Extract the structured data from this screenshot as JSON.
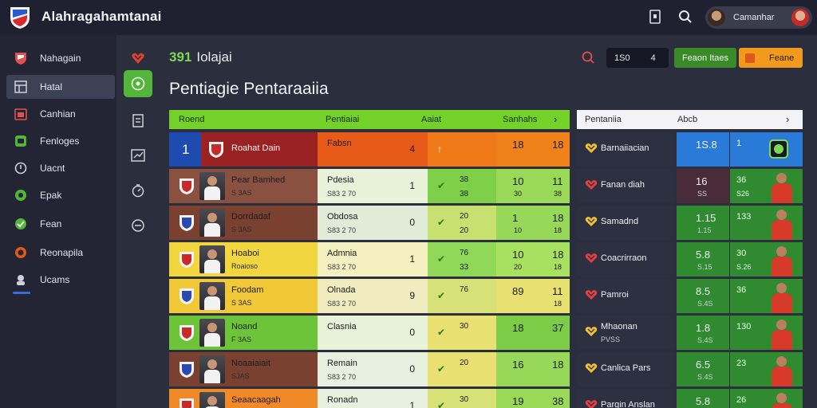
{
  "app": {
    "title": "Alahraga​hamtanai",
    "user_name": "Camanhar"
  },
  "sidebar": {
    "items": [
      {
        "label": "Nahagain",
        "icon": "shield-icon",
        "color": "#e05050"
      },
      {
        "label": "Hatal",
        "icon": "table-icon",
        "color": "#d0d0d8",
        "active": true
      },
      {
        "label": "Canhian",
        "icon": "calendar-icon",
        "color": "#e05050"
      },
      {
        "label": "Fenloges",
        "icon": "chat-icon",
        "color": "#53b63a"
      },
      {
        "label": "Uacnt",
        "icon": "circle-icon",
        "color": "#d0d0d8"
      },
      {
        "label": "Epak",
        "icon": "gear-icon",
        "color": "#53b63a"
      },
      {
        "label": "Fean",
        "icon": "check-icon",
        "color": "#53b63a"
      },
      {
        "label": "Reonapila",
        "icon": "target-icon",
        "color": "#e0581a"
      },
      {
        "label": "Ucams",
        "icon": "users-icon",
        "color": "#d0d0d8"
      }
    ]
  },
  "header": {
    "section_number": "391",
    "section_label": "Iolajai",
    "page_title": "Pentiagie Pentaraaiia",
    "dark_pill": {
      "a": "1S0",
      "b": "4"
    },
    "green_button": "Feaon Itaes",
    "orange_button": "Feane"
  },
  "table": {
    "headers": {
      "col1": "Roend",
      "col2": "Pentiaiai",
      "col3": "Aaiat",
      "col4": "Sanhahs"
    },
    "rows": [
      {
        "name": "Roahat Dain",
        "sub": "",
        "rank": "1",
        "opp": "Fabsn",
        "opp_sub": "",
        "opp_num": "4",
        "mark": "↑",
        "v3": "",
        "v3b": "",
        "v4": "18",
        "v5": "18",
        "v4b": "",
        "v5b": "",
        "c1": "#9a2222",
        "c2": "#e85a18",
        "c3": "#f07a18",
        "c4": "#f0801a"
      },
      {
        "name": "Pear Bamhed",
        "sub": "S 3AS",
        "opp": "Pdesia",
        "opp_sub": "S83 2 70",
        "opp_num": "1",
        "mark": "✔",
        "v3": "38",
        "v3b": "38",
        "v4": "10",
        "v5": "11",
        "v4b": "30",
        "v5b": "38",
        "c1": "#8a5040",
        "c2": "#e8f2d8",
        "c3": "#7dd048",
        "c4": "#9ad858"
      },
      {
        "name": "Dorrdadaf",
        "sub": "S 3AS",
        "opp": "Obdosa",
        "opp_sub": "S83 2 70",
        "opp_num": "0",
        "mark": "✔",
        "v3": "20",
        "v3b": "20",
        "v4": "1",
        "v5": "18",
        "v4b": "10",
        "v5b": "18",
        "c1": "#7a4030",
        "c2": "#e0ecd8",
        "c3": "#c8e070",
        "c4": "#98d858"
      },
      {
        "name": "Hoaboi",
        "sub": "Roaioso",
        "opp": "Admnia",
        "opp_sub": "S83 2 70",
        "opp_num": "1",
        "mark": "✔",
        "v3": "76",
        "v3b": "33",
        "v4": "10",
        "v5": "18",
        "v4b": "20",
        "v5b": "18",
        "c1": "#f2d640",
        "c2": "#f4f0c0",
        "c3": "#8fd858",
        "c4": "#a8e060"
      },
      {
        "name": "Foodam",
        "sub": "S 3AS",
        "opp": "Olnada",
        "opp_sub": "S83 2 70",
        "opp_num": "9",
        "mark": "✔",
        "v3": "76",
        "v3b": "",
        "v4": "89",
        "v5": "11",
        "v4b": "",
        "v5b": "18",
        "c1": "#f0c838",
        "c2": "#f0ecc0",
        "c3": "#d8e078",
        "c4": "#e8e070"
      },
      {
        "name": "Noand",
        "sub": "F 3AS",
        "opp": "Clasnia",
        "opp_sub": "",
        "opp_num": "0",
        "mark": "✔",
        "v3": "30",
        "v3b": "",
        "v4": "18",
        "v5": "37",
        "v4b": "",
        "v5b": "",
        "c1": "#6ec438",
        "c2": "#e8f2d8",
        "c3": "#e8e070",
        "c4": "#7dcc48"
      },
      {
        "name": "Noaaiaiait",
        "sub": "SJAS",
        "opp": "Remain",
        "opp_sub": "S83 2 70",
        "opp_num": "0",
        "mark": "✔",
        "v3": "20",
        "v3b": "",
        "v4": "16",
        "v5": "18",
        "v4b": "",
        "v5b": "",
        "c1": "#7a4030",
        "c2": "#e8f0e0",
        "c3": "#e8e070",
        "c4": "#98d858"
      },
      {
        "name": "Seaacaagah",
        "sub": "",
        "opp": "Ronadn",
        "opp_sub": "",
        "opp_num": "1",
        "mark": "✔",
        "v3": "30",
        "v3b": "",
        "v4": "19",
        "v5": "38",
        "v4b": "",
        "v5b": "",
        "c1": "#f08a28",
        "c2": "#e8f0e0",
        "c3": "#d8e078",
        "c4": "#9ad858"
      }
    ]
  },
  "panel": {
    "headers": {
      "col1": "Pentaniia",
      "col2": "Abcb"
    },
    "rows": [
      {
        "name": "Barnaiiacian",
        "sub": "",
        "v": "1S.8",
        "vb": "",
        "n": "1",
        "nb": "",
        "icon_color": "#f2c030",
        "r2": "#2a7ad8",
        "r3": "#2a7ad8"
      },
      {
        "name": "Fanan diah",
        "sub": "",
        "v": "16",
        "vb": "SS",
        "n": "36",
        "nb": "S26",
        "icon_color": "#e04040",
        "r2": "#4a2b3a",
        "r3": "#2f8a30"
      },
      {
        "name": "Samadnd",
        "sub": "",
        "v": "1.15",
        "vb": "1.15",
        "n": "133",
        "nb": "",
        "icon_color": "#f2c030",
        "r2": "#2f8a30",
        "r3": "#2f8a30"
      },
      {
        "name": "Coacrirraon",
        "sub": "",
        "v": "5.8",
        "vb": "S.15",
        "n": "30",
        "nb": "S.26",
        "icon_color": "#e04040",
        "r2": "#2f8a30",
        "r3": "#2f8a30"
      },
      {
        "name": "Pamroi",
        "sub": "",
        "v": "8.5",
        "vb": "S.4S",
        "n": "36",
        "nb": "",
        "icon_color": "#e04040",
        "r2": "#2f8a30",
        "r3": "#2f8a30"
      },
      {
        "name": "Mhaonan",
        "sub": "PVSS",
        "v": "1.8",
        "vb": "S.4S",
        "n": "130",
        "nb": "",
        "icon_color": "#f2c030",
        "r2": "#2f8a30",
        "r3": "#2f8a30"
      },
      {
        "name": "Canlica Pars",
        "sub": "",
        "v": "6.5",
        "vb": "S.4S",
        "n": "23",
        "nb": "",
        "icon_color": "#f2c030",
        "r2": "#2f8a30",
        "r3": "#2f8a30"
      },
      {
        "name": "Pargin Anslan",
        "sub": "",
        "v": "5.8",
        "vb": "",
        "n": "26",
        "nb": "",
        "icon_color": "#e04040",
        "r2": "#2f8a30",
        "r3": "#2f8a30"
      }
    ]
  }
}
